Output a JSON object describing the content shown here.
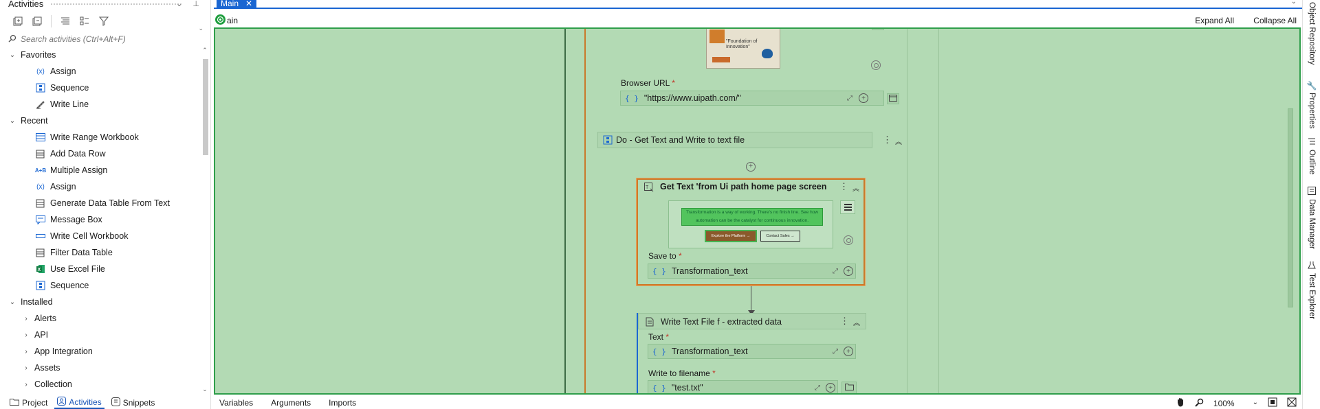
{
  "activities_panel": {
    "title": "Activities",
    "search_placeholder": "Search activities (Ctrl+Alt+F)",
    "favorites_label": "Favorites",
    "favorites": [
      {
        "label": "Assign",
        "icon": "assign-icon"
      },
      {
        "label": "Sequence",
        "icon": "sequence-icon"
      },
      {
        "label": "Write Line",
        "icon": "write-line-icon"
      }
    ],
    "recent_label": "Recent",
    "recent": [
      {
        "label": "Write Range Workbook",
        "icon": "write-range-icon"
      },
      {
        "label": "Add Data Row",
        "icon": "data-row-icon"
      },
      {
        "label": "Multiple Assign",
        "icon": "multiple-assign-icon"
      },
      {
        "label": "Assign",
        "icon": "assign-icon"
      },
      {
        "label": "Generate Data Table From Text",
        "icon": "data-table-icon"
      },
      {
        "label": "Message Box",
        "icon": "message-box-icon"
      },
      {
        "label": "Write Cell Workbook",
        "icon": "write-cell-icon"
      },
      {
        "label": "Filter Data Table",
        "icon": "filter-table-icon"
      },
      {
        "label": "Use Excel File",
        "icon": "excel-icon"
      },
      {
        "label": "Sequence",
        "icon": "sequence-icon"
      }
    ],
    "installed_label": "Installed",
    "installed": [
      "Alerts",
      "API",
      "App Integration",
      "Assets",
      "Collection"
    ],
    "bottom_tabs": [
      "Project",
      "Activities",
      "Snippets"
    ]
  },
  "document": {
    "tab_label": "Main",
    "breadcrumb": "ain",
    "expand_all": "Expand All",
    "collapse_all": "Collapse All"
  },
  "workflow": {
    "browser_url_label": "Browser URL",
    "browser_url_value": "\"https://www.uipath.com/\"",
    "do_title": "Do - Get Text and Write to text file",
    "get_text": {
      "title": "Get Text 'from Ui path  home page screen",
      "preview_text": "Transformation is a way of working. There's no finish line. See how automation can be the catalyst for continuous innovation.",
      "preview_btn1": "Explore the Platform →",
      "preview_btn2": "Contact Sales →",
      "save_to_label": "Save to",
      "save_to_value": "Transformation_text"
    },
    "write_text": {
      "title": "Write Text File f - extracted data",
      "text_label": "Text",
      "text_value": "Transformation_text",
      "filename_label": "Write to filename",
      "filename_value": "\"test.txt\""
    },
    "thumb_text": "\"Foundation of Innovation\""
  },
  "designer_bottom": {
    "tabs": [
      "Variables",
      "Arguments",
      "Imports"
    ],
    "zoom": "100%"
  },
  "right_strip": [
    "Object Repository",
    "Properties",
    "Outline",
    "Data Manager",
    "Test Explorer"
  ],
  "colors": {
    "accent": "#1a66d2",
    "canvas_bg": "#b3dab4",
    "selected_border": "#cc7a2a",
    "canvas_border": "#2e9e4a"
  }
}
